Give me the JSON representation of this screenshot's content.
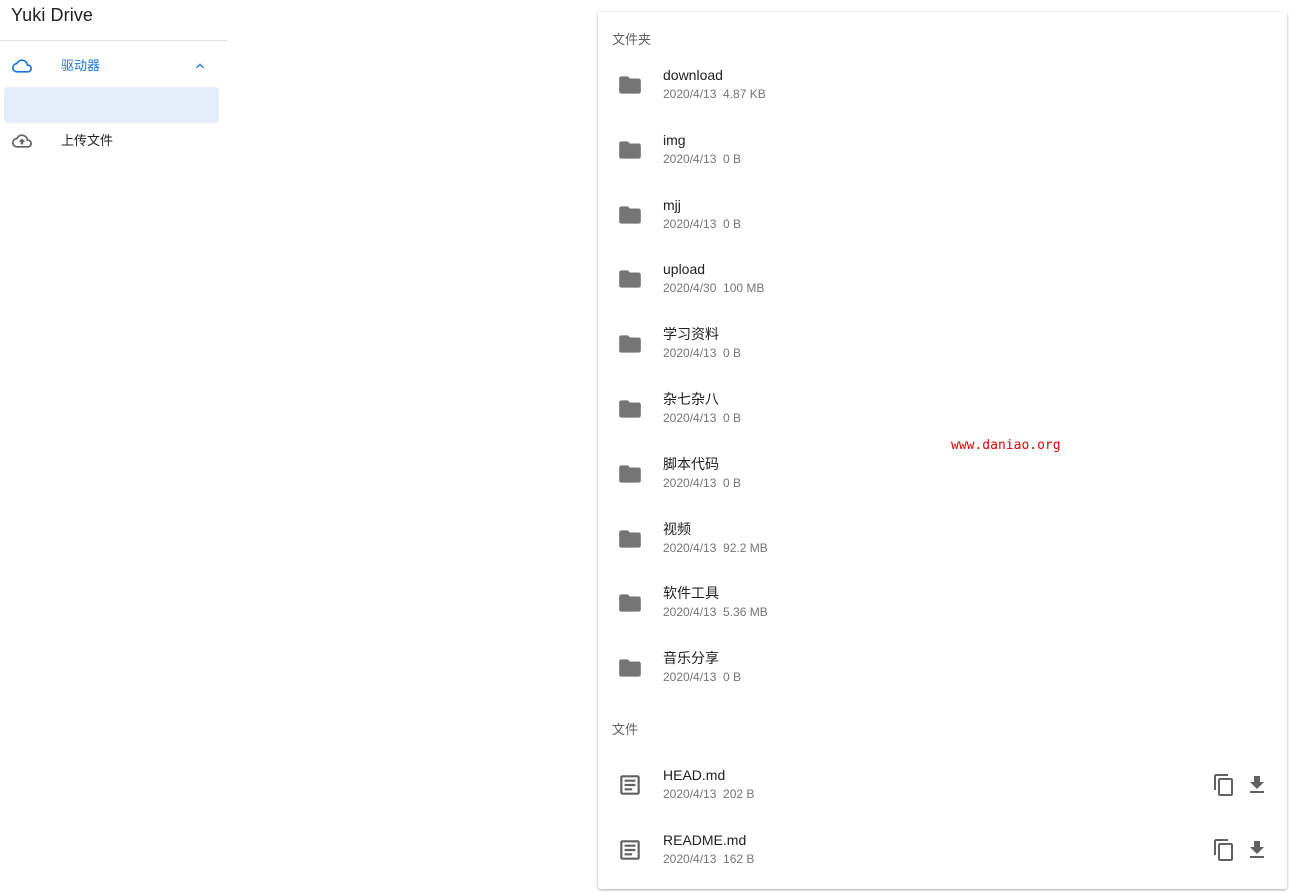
{
  "app": {
    "title": "Yuki Drive"
  },
  "sidebar": {
    "items": [
      {
        "label": "驱动器",
        "icon": "cloud-icon",
        "expanded": true
      },
      {
        "label": "上传文件",
        "icon": "cloud-upload-icon"
      }
    ],
    "sub_item": {
      "label": ""
    }
  },
  "folders": {
    "header": "文件夹",
    "items": [
      {
        "name": "download",
        "date": "2020/4/13",
        "size": "4.87 KB"
      },
      {
        "name": "img",
        "date": "2020/4/13",
        "size": "0 B"
      },
      {
        "name": "mjj",
        "date": "2020/4/13",
        "size": "0 B"
      },
      {
        "name": "upload",
        "date": "2020/4/30",
        "size": "100 MB"
      },
      {
        "name": "学习资料",
        "date": "2020/4/13",
        "size": "0 B"
      },
      {
        "name": "杂七杂八",
        "date": "2020/4/13",
        "size": "0 B"
      },
      {
        "name": "脚本代码",
        "date": "2020/4/13",
        "size": "0 B"
      },
      {
        "name": "视频",
        "date": "2020/4/13",
        "size": "92.2 MB"
      },
      {
        "name": "软件工具",
        "date": "2020/4/13",
        "size": "5.36 MB"
      },
      {
        "name": "音乐分享",
        "date": "2020/4/13",
        "size": "0 B"
      }
    ]
  },
  "files": {
    "header": "文件",
    "items": [
      {
        "name": "HEAD.md",
        "date": "2020/4/13",
        "size": "202 B"
      },
      {
        "name": "README.md",
        "date": "2020/4/13",
        "size": "162 B"
      }
    ]
  },
  "watermark": "www.daniao.org",
  "colors": {
    "accent": "#1976d2",
    "selected_bg": "#e3eefa",
    "icon_gray": "#757575",
    "watermark": "#e00000"
  }
}
